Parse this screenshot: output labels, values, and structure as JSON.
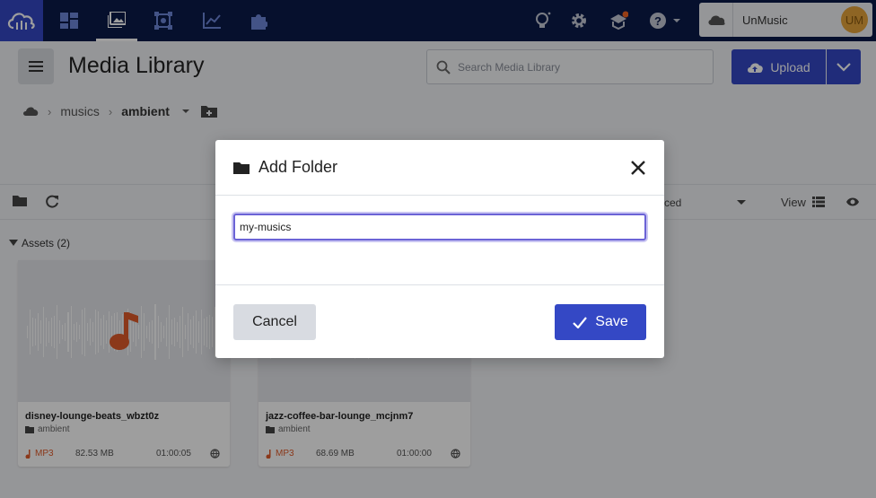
{
  "app": {
    "account_name": "UnMusic",
    "avatar_initials": "UM",
    "brand_color": "#3448c5"
  },
  "nav": {
    "items": [
      {
        "icon": "dashboard-icon"
      },
      {
        "icon": "media-library-icon",
        "active": true
      },
      {
        "icon": "transform-icon"
      },
      {
        "icon": "analytics-icon"
      },
      {
        "icon": "addons-icon"
      }
    ]
  },
  "header": {
    "title": "Media Library",
    "search_placeholder": "Search Media Library",
    "upload_label": "Upload"
  },
  "breadcrumb": {
    "items": [
      "musics",
      "ambient"
    ]
  },
  "toolbar": {
    "sort_text": "ced",
    "view_label": "View"
  },
  "assets": {
    "heading": "Assets (2)",
    "cards": [
      {
        "title": "disney-lounge-beats_wbzt0z",
        "folder": "ambient",
        "format": "MP3",
        "size": "82.53 MB",
        "duration": "01:00:05"
      },
      {
        "title": "jazz-coffee-bar-lounge_mcjnm7",
        "folder": "ambient",
        "format": "MP3",
        "size": "68.69 MB",
        "duration": "01:00:00"
      }
    ]
  },
  "modal": {
    "title": "Add Folder",
    "input_value": "my-musics",
    "cancel_label": "Cancel",
    "save_label": "Save"
  }
}
